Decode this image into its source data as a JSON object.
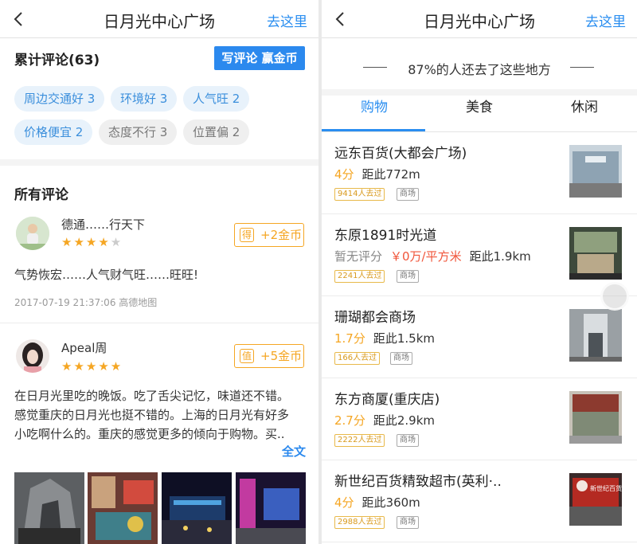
{
  "left": {
    "header": {
      "title": "日月光中心广场",
      "action": "去这里"
    },
    "review_summary": {
      "title": "累计评论(63)",
      "write_button": "写评论 赢金币"
    },
    "tags": [
      {
        "label": "周边交通好 3",
        "sentiment": "positive"
      },
      {
        "label": "环境好 3",
        "sentiment": "positive"
      },
      {
        "label": "人气旺 2",
        "sentiment": "positive"
      },
      {
        "label": "价格便宜 2",
        "sentiment": "positive"
      },
      {
        "label": "态度不行 3",
        "sentiment": "negative"
      },
      {
        "label": "位置偏 2",
        "sentiment": "negative"
      }
    ],
    "all_reviews_title": "所有评论",
    "reviews": [
      {
        "user": "德通……行天下",
        "rating": 4,
        "coin_mark": "得",
        "coin_text": "+2金币",
        "text": "气势恢宏……人气财气旺……旺旺!",
        "meta": "2017-07-19 21:37:06 高德地图"
      },
      {
        "user": "Apeal周",
        "rating": 5,
        "coin_mark": "值",
        "coin_text": "+5金币",
        "text_lines": [
          "在日月光里吃的晚饭。吃了舌尖记忆，味道还不错。",
          "感觉重庆的日月光也挺不错的。上海的日月光有好多",
          "小吃啊什么的。重庆的感觉更多的倾向于购物。买.."
        ],
        "full_text_link": "全文"
      }
    ]
  },
  "right": {
    "header": {
      "title": "日月光中心广场",
      "action": "去这里"
    },
    "banner": "87%的人还去了这些地方",
    "tabs": [
      {
        "label": "购物",
        "active": true
      },
      {
        "label": "美食",
        "active": false
      },
      {
        "label": "休闲",
        "active": false
      }
    ],
    "places": [
      {
        "name": "远东百货(大都会广场)",
        "score": "4分",
        "price": "",
        "distance": "距此772m",
        "visits": "9414人去过",
        "category": "商场"
      },
      {
        "name": "东原1891时光道",
        "score": "暂无评分",
        "price": "￥0万/平方米",
        "distance": "距此1.9km",
        "visits": "2241人去过",
        "category": "商场"
      },
      {
        "name": "珊瑚都会商场",
        "score": "1.7分",
        "price": "",
        "distance": "距此1.5km",
        "visits": "166人去过",
        "category": "商场"
      },
      {
        "name": "东方商厦(重庆店)",
        "score": "2.7分",
        "price": "",
        "distance": "距此2.9km",
        "visits": "2222人去过",
        "category": "商场"
      },
      {
        "name": "新世纪百货精致超市(英利·..",
        "score": "4分",
        "price": "",
        "distance": "距此360m",
        "visits": "2988人去过",
        "category": "商场",
        "thumb_sign": "新世纪百货"
      }
    ]
  },
  "colors": {
    "accent": "#2a8ef0",
    "star": "#f5a623",
    "price": "#f0553a"
  }
}
